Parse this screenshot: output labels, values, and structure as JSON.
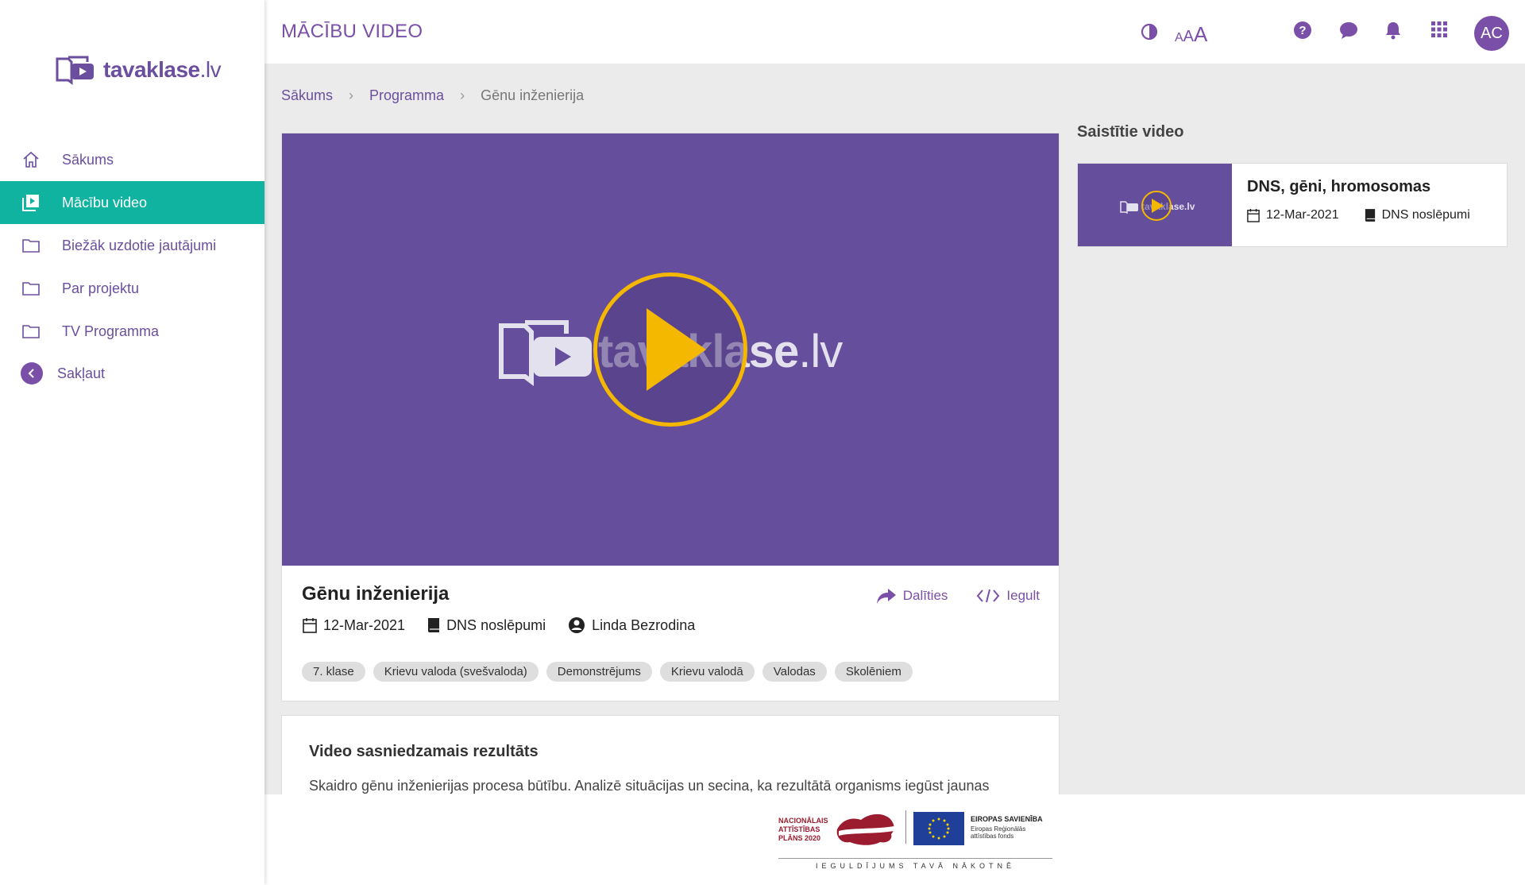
{
  "app": {
    "logo_main": "tavaklase",
    "logo_suffix": ".lv",
    "page_heading": "MĀCĪBU VIDEO"
  },
  "header": {
    "font_size_small": "A",
    "font_size_medium": "A",
    "font_size_large": "A",
    "avatar_initials": "AC",
    "brand_color": "#7a4fa8"
  },
  "sidebar": {
    "active_color": "#0fb3a0",
    "items": [
      {
        "label": "Sākums",
        "icon": "home-icon"
      },
      {
        "label": "Mācību video",
        "icon": "video-library-icon",
        "active": true
      },
      {
        "label": "Biežāk uzdotie jautājumi",
        "icon": "folder-icon"
      },
      {
        "label": "Par projektu",
        "icon": "folder-icon"
      },
      {
        "label": "TV Programma",
        "icon": "folder-icon"
      }
    ],
    "collapse_label": "Sakļaut"
  },
  "breadcrumb": {
    "items": [
      "Sākums",
      "Programma"
    ],
    "current": "Gēnu inženierija"
  },
  "video": {
    "title": "Gēnu inženierija",
    "date": "12-Mar-2021",
    "series": "DNS noslēpumi",
    "author": "Linda Bezrodina",
    "share_label": "Dalīties",
    "embed_label": "Iegult",
    "tags": [
      "7. klase",
      "Krievu valoda (svešvaloda)",
      "Demonstrējums",
      "Krievu valodā",
      "Valodas",
      "Skolēniem"
    ],
    "logo_main": "tavaklase",
    "logo_suffix": ".lv"
  },
  "result": {
    "heading": "Video sasniedzamais rezultāts",
    "text": "Skaidro gēnu inženierijas procesa būtību. Analizē situācijas un secina, ka rezultātā organisms iegūst jaunas"
  },
  "related": {
    "heading": "Saistītie video",
    "items": [
      {
        "title": "DNS, gēni, hromosomas",
        "date": "12-Mar-2021",
        "series": "DNS noslēpumi",
        "logo_main": "tavaklase",
        "logo_suffix": ".lv"
      }
    ]
  },
  "footer": {
    "nap_line1": "NACIONĀLAIS",
    "nap_line2": "ATTĪSTĪBAS",
    "nap_line3": "PLĀNS 2020",
    "eu_title": "EIROPAS SAVIENĪBA",
    "eu_sub1": "Eiropas Reģionālās",
    "eu_sub2": "attīstības fonds",
    "invest_text": "IEGULDĪJUMS TAVĀ NĀKOTNĒ"
  }
}
